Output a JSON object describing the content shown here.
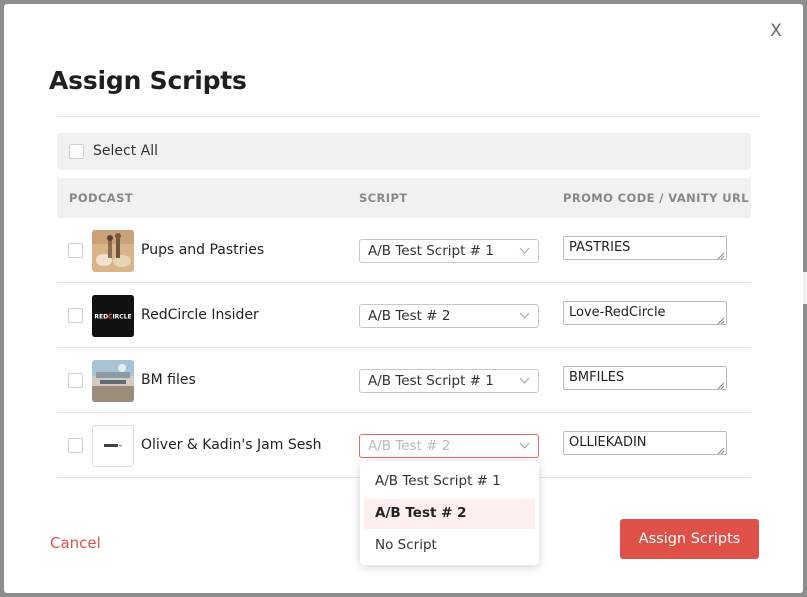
{
  "modal": {
    "title": "Assign Scripts",
    "close_label": "X",
    "select_all_label": "Select All"
  },
  "table": {
    "headers": [
      "PODCAST",
      "SCRIPT",
      "PROMO CODE / VANITY URL"
    ],
    "rows": [
      {
        "name": "Pups and Pastries",
        "script": "A/B Test Script # 1",
        "promo": "PASTRIES",
        "checked": false
      },
      {
        "name": "RedCircle Insider",
        "script": "A/B Test # 2",
        "promo": "Love-RedCircle",
        "checked": false
      },
      {
        "name": "BM files",
        "script": "A/B Test Script # 1",
        "promo": "BMFILES",
        "checked": false
      },
      {
        "name": "Oliver & Kadin's Jam Sesh",
        "script": "A/B Test # 2",
        "promo": "OLLIEKADIN",
        "checked": false
      }
    ]
  },
  "dropdown": {
    "options": [
      "A/B Test Script # 1",
      "A/B Test # 2",
      "No Script"
    ],
    "selected": "A/B Test # 2"
  },
  "footer": {
    "cancel_label": "Cancel",
    "assign_label": "Assign Scripts"
  },
  "colors": {
    "accent": "#df5048",
    "highlight": "#fdf0ee",
    "header_bg": "#f1f1f1"
  },
  "icons": {
    "close": "x-icon",
    "chevron": "chevron-down-icon",
    "resize": "resize-grip-icon"
  }
}
